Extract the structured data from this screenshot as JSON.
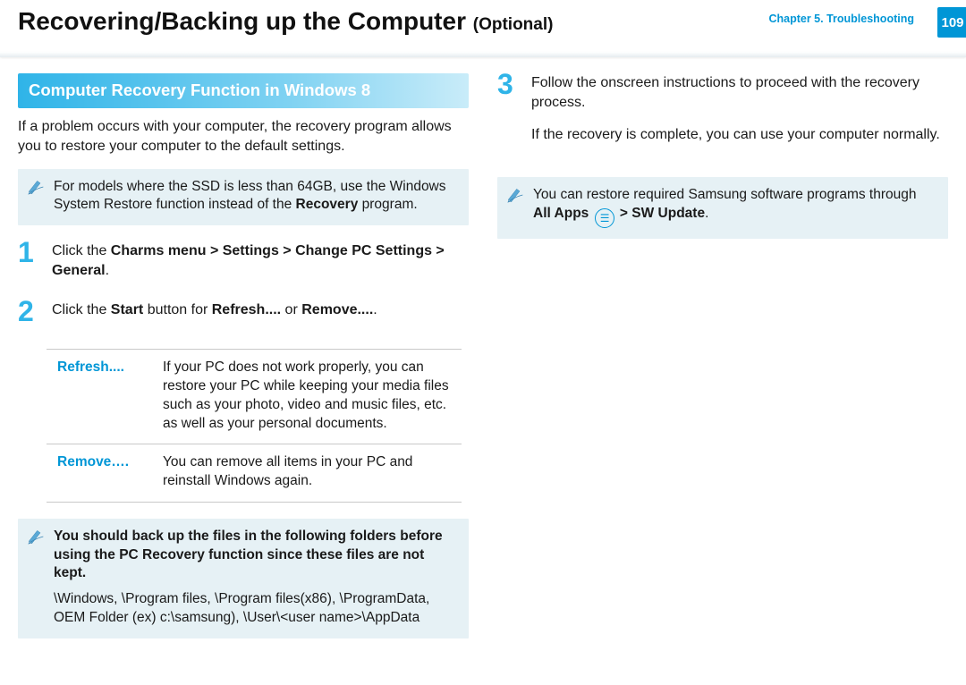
{
  "header": {
    "title_main": "Recovering/Backing up the Computer",
    "title_opt": "(Optional)",
    "chapter_line1": "Chapter 5.",
    "chapter_line2": "Troubleshooting",
    "page_number": "109"
  },
  "left": {
    "section_heading": "Computer Recovery Function in Windows 8",
    "intro": "If a problem occurs with your computer, the recovery program allows you to restore your computer to the default settings.",
    "note1_a": "For models where the SSD is less than 64GB, use the Windows System Restore function instead of the ",
    "note1_b": "Recovery",
    "note1_c": " program.",
    "step1_num": "1",
    "step1_a": "Click the ",
    "step1_b": "Charms menu > Settings > Change PC Settings > General",
    "step1_c": ".",
    "step2_num": "2",
    "step2_a": "Click the ",
    "step2_b": "Start",
    "step2_c": " button for ",
    "step2_d": "Refresh....",
    "step2_e": " or ",
    "step2_f": "Remove....",
    "step2_g": ".",
    "table": {
      "row1_key": "Refresh....",
      "row1_val": "If your PC does not work properly, you can restore your PC while keeping your media files such as your photo, video and music files, etc. as well as your personal documents.",
      "row2_key": "Remove….",
      "row2_val": "You can remove all items in your PC and reinstall Windows again."
    },
    "note2_bold": "You should back up the files in the following folders before using the PC Recovery function since these files are not kept.",
    "note2_paths": "\\Windows, \\Program files, \\Program files(x86), \\ProgramData, OEM Folder (ex) c:\\samsung), \\User\\<user name>\\AppData"
  },
  "right": {
    "step3_num": "3",
    "step3_a": "Follow the onscreen instructions to proceed with the recovery process.",
    "step3_b": "If the recovery is complete, you can use your computer normally.",
    "note3_a": "You can restore required Samsung software programs through ",
    "note3_b": "All Apps",
    "note3_c": " > ",
    "note3_d": "SW Update",
    "note3_e": "."
  }
}
